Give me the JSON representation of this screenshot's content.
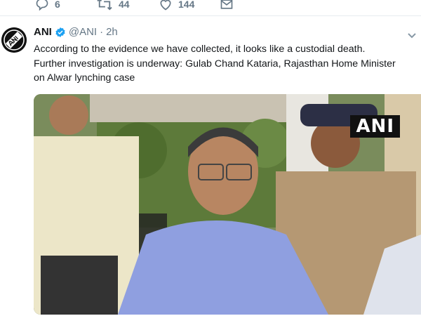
{
  "previous_tweet": {
    "actions": {
      "reply_count": "6",
      "retweet_count": "44",
      "like_count": "144"
    }
  },
  "tweet": {
    "author_name": "ANI",
    "handle": "@ANI",
    "separator": "·",
    "time": "2h",
    "verified": true,
    "text": "According to the evidence we have collected, it looks like a custodial death.\nFurther investigation is underway: Gulab Chand Kataria, Rajasthan Home Minister\non Alwar lynching case",
    "media": {
      "watermark": "ANI"
    }
  },
  "colors": {
    "text": "#14171a",
    "muted": "#657786",
    "verified_blue": "#1da1f2",
    "divider": "#e6ecf0"
  },
  "icons": [
    "reply-icon",
    "retweet-icon",
    "like-icon",
    "direct-message-icon",
    "verified-badge-icon",
    "caret-down-icon",
    "ani-logo"
  ]
}
